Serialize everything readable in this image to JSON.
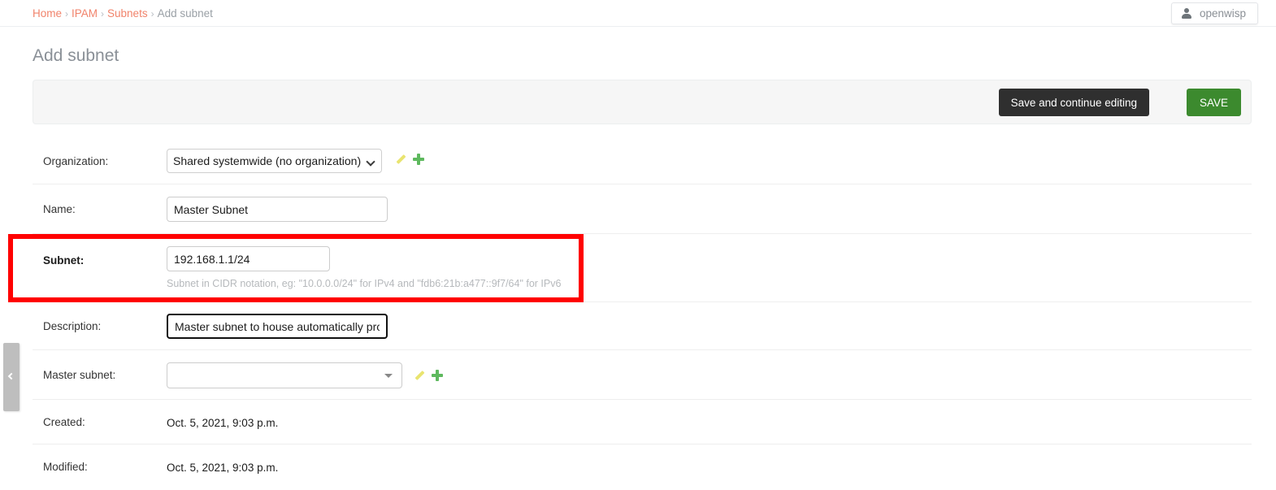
{
  "breadcrumb": {
    "items": [
      {
        "label": "Home",
        "link": true
      },
      {
        "label": "IPAM",
        "link": true
      },
      {
        "label": "Subnets",
        "link": true
      },
      {
        "label": "Add subnet",
        "link": false
      }
    ],
    "separator": "›"
  },
  "user_menu": {
    "username": "openwisp",
    "icon": "person-icon"
  },
  "page": {
    "title": "Add subnet"
  },
  "toolbar": {
    "save_continue_label": "Save and continue editing",
    "save_label": "SAVE",
    "save_continue_color": "#2f2f2f",
    "save_color": "#3c8a2e"
  },
  "form": {
    "organization": {
      "label": "Organization:",
      "value": "Shared systemwide (no organization)",
      "options": [
        "Shared systemwide (no organization)"
      ],
      "edit_icon": "pencil-icon",
      "add_icon": "plus-icon"
    },
    "name": {
      "label": "Name:",
      "value": "Master Subnet",
      "placeholder": ""
    },
    "subnet": {
      "label": "Subnet:",
      "value": "192.168.1.1/24",
      "placeholder": "",
      "help_text": "Subnet in CIDR notation, eg: \"10.0.0.0/24\" for IPv4 and \"fdb6:21b:a477::9f7/64\" for IPv6",
      "required": true,
      "highlighted": true
    },
    "description": {
      "label": "Description:",
      "value": "Master subnet to house automatically prc",
      "focused": true
    },
    "master_subnet": {
      "label": "Master subnet:",
      "value": "",
      "placeholder": "",
      "edit_icon": "pencil-icon",
      "add_icon": "plus-icon"
    },
    "created": {
      "label": "Created:",
      "value": "Oct. 5, 2021, 9:03 p.m."
    },
    "modified": {
      "label": "Modified:",
      "value": "Oct. 5, 2021, 9:03 p.m."
    }
  },
  "annotation": {
    "color": "#ff0000",
    "target": "subnet-field-row"
  },
  "sidebar_handle": {
    "icon": "chevron-left-icon"
  }
}
